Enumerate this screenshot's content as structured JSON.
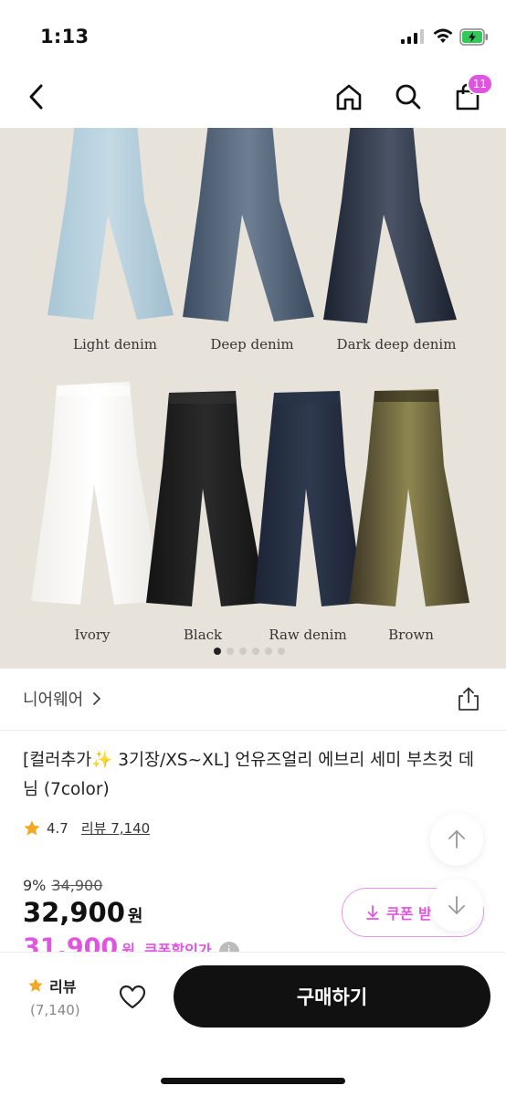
{
  "status_bar": {
    "time": "1:13"
  },
  "nav": {
    "cart_count": "11"
  },
  "product_image": {
    "colors": [
      "Light denim",
      "Deep denim",
      "Dark deep denim",
      "Ivory",
      "Black",
      "Raw denim",
      "Brown"
    ],
    "carousel_pages": 6,
    "carousel_active_index": 0
  },
  "brand": {
    "name": "니어웨어"
  },
  "product": {
    "title": "[컬러추가✨ 3기장/XS~XL] 언유즈얼리 에브리 세미 부츠컷 데님 (7color)",
    "rating": "4.7",
    "review_label": "리뷰 7,140",
    "discount_rate": "9%",
    "original_price": "34,900",
    "price": "32,900",
    "price_unit": "원",
    "coupon_price": "31,900",
    "coupon_price_unit": "원",
    "coupon_label": "쿠폰할인가",
    "coupon_info": "i"
  },
  "coupon_button": {
    "label": "쿠폰 받"
  },
  "bottom_bar": {
    "review_label": "리뷰",
    "review_count": "(7,140)",
    "buy_label": "구매하기"
  },
  "colors": {
    "accent": "#e055e0",
    "buy_button": "#111111",
    "image_background": "#e7e2da"
  }
}
